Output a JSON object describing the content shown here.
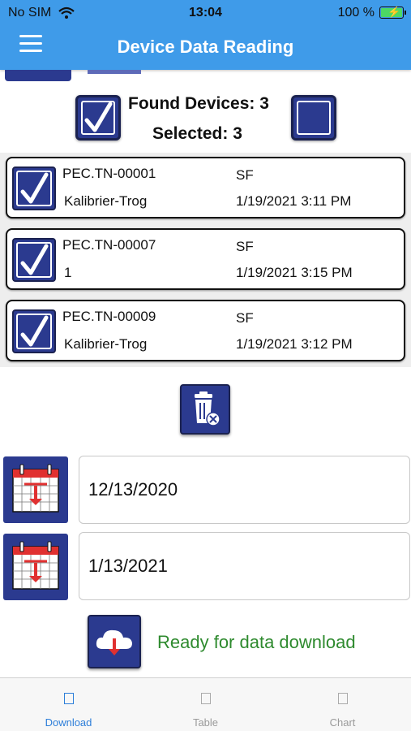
{
  "status_bar": {
    "carrier": "No SIM",
    "time": "13:04",
    "battery": "100 %"
  },
  "nav": {
    "title": "Device Data Reading"
  },
  "summary": {
    "found_text": "Found Devices:  3",
    "selected_text": "Selected:  3"
  },
  "devices": [
    {
      "id": "PEC.TN-00001",
      "type": "SF",
      "name": "Kalibrier-Trog",
      "date": "1/19/2021 3:11 PM"
    },
    {
      "id": "PEC.TN-00007",
      "type": "SF",
      "name": "1",
      "date": "1/19/2021 3:15 PM"
    },
    {
      "id": "PEC.TN-00009",
      "type": "SF",
      "name": "Kalibrier-Trog",
      "date": "1/19/2021 3:12 PM"
    }
  ],
  "dates": {
    "start": "12/13/2020",
    "end": "1/13/2021"
  },
  "download": {
    "status": "Ready for data download",
    "status_color": "#2e8a2e"
  },
  "tabs": [
    {
      "label": "Download",
      "icon": "download-tab-icon"
    },
    {
      "label": "Table",
      "icon": "table-tab-icon"
    },
    {
      "label": "Chart",
      "icon": "chart-tab-icon"
    }
  ],
  "colors": {
    "nav_bar": "#3f9be9",
    "button_blue": "#2b3a8f",
    "calendar_red": "#e03030",
    "tab_active": "#2d7ed9"
  }
}
